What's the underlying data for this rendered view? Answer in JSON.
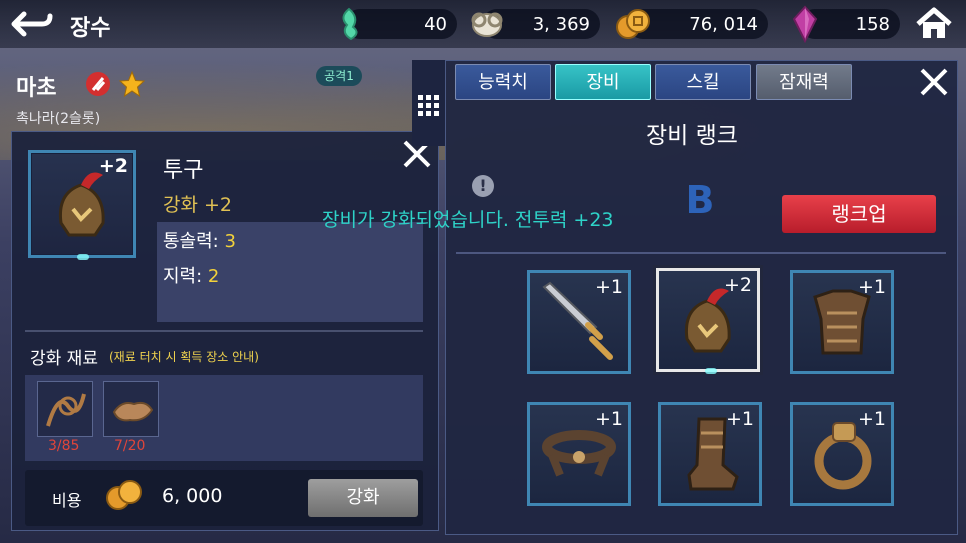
{
  "header": {
    "title": "장수",
    "resources": [
      {
        "icon": "spirit-icon",
        "value": "40"
      },
      {
        "icon": "ram-icon",
        "value": "3, 369"
      },
      {
        "icon": "coin-icon",
        "value": "76, 014"
      },
      {
        "icon": "gem-icon",
        "value": "158"
      }
    ]
  },
  "hero": {
    "name": "마초",
    "subtitle": "촉나라(2슬롯)",
    "badge": "공격1"
  },
  "item": {
    "plus": "+2",
    "name": "투구",
    "enhance_label": "강화 +2",
    "stat1_label": "통솔력: ",
    "stat1_value": "3",
    "stat2_label": "지력: ",
    "stat2_value": "2"
  },
  "materials": {
    "title": "강화 재료",
    "hint": "(재료 터치 시 획득 장소 안내)",
    "items": [
      {
        "icon": "rope-icon",
        "count": "3/85"
      },
      {
        "icon": "leather-icon",
        "count": "7/20"
      }
    ]
  },
  "cost": {
    "label": "비용",
    "value": "6, 000",
    "button": "강화"
  },
  "tabs": [
    {
      "label": "능력치"
    },
    {
      "label": "장비"
    },
    {
      "label": "스킬"
    },
    {
      "label": "잠재력"
    }
  ],
  "rank": {
    "title": "장비 랭크",
    "grade": "B",
    "button": "랭크업",
    "toast": "장비가 강화되었습니다.  전투력 +23"
  },
  "gear": [
    {
      "name": "sword",
      "plus": "+1"
    },
    {
      "name": "helmet",
      "plus": "+2"
    },
    {
      "name": "armor",
      "plus": "+1"
    },
    {
      "name": "belt",
      "plus": "+1"
    },
    {
      "name": "boots",
      "plus": "+1"
    },
    {
      "name": "ring",
      "plus": "+1"
    }
  ],
  "colors": {
    "accent_teal": "#1a9aa4",
    "rank_up_red": "#d62d3a",
    "enhance_gold": "#e0c154"
  }
}
